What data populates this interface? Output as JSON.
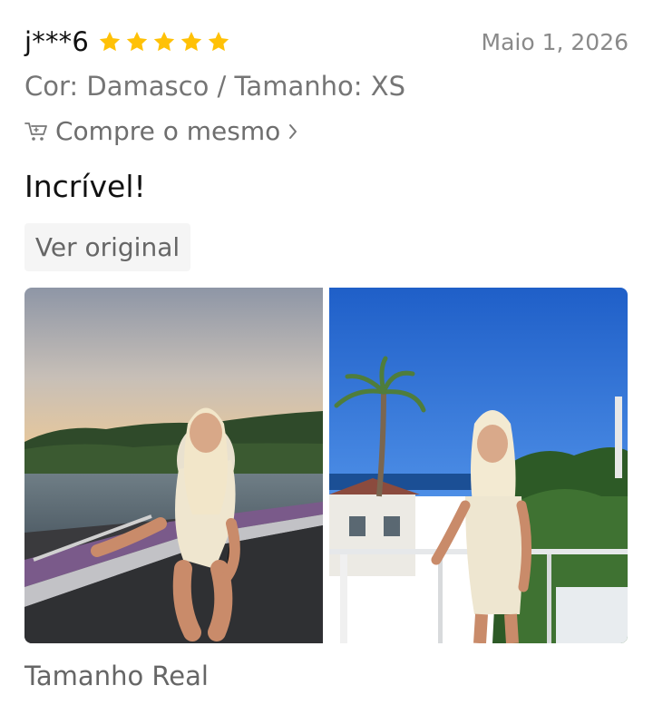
{
  "review": {
    "username": "j***6",
    "rating": 5,
    "date": "Maio 1,  2026",
    "variant": "Cor: Damasco / Tamanho: XS",
    "buy_same_label": "Compre o mesmo",
    "text": "Incrível!",
    "translate_label": "Ver original",
    "size_note": "Tamanho Real"
  },
  "photos": [
    {
      "name": "photo-boat-sunset"
    },
    {
      "name": "photo-balcony-palm"
    }
  ],
  "colors": {
    "star": "#FFC107",
    "text_primary": "#111111",
    "text_secondary": "#757575",
    "button_bg": "#F5F5F5"
  },
  "icons": {
    "star": "star-icon",
    "cart": "cart-icon",
    "chevron": "chevron-right-icon"
  }
}
